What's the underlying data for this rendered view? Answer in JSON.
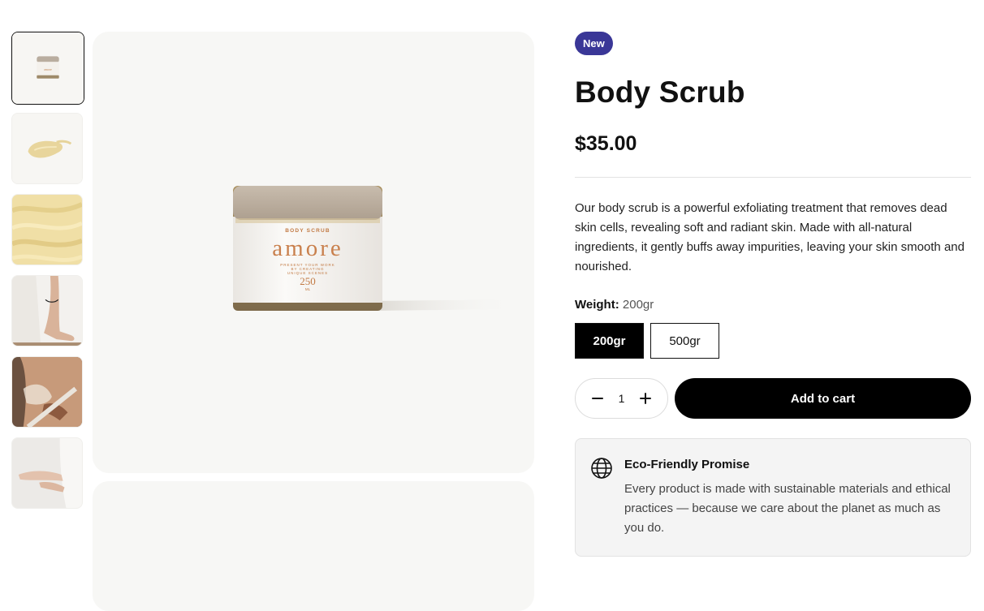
{
  "product": {
    "badge": "New",
    "title": "Body Scrub",
    "price": "$35.00",
    "description": "Our body scrub is a powerful exfoliating treatment that removes dead skin cells, revealing soft and radiant skin. Made with all-natural ingredients, it gently buffs away impurities, leaving your skin smooth and nourished.",
    "weight_label": "Weight:",
    "weight_value": "200gr",
    "options": [
      "200gr",
      "500gr"
    ],
    "quantity": "1",
    "add_to_cart": "Add to cart"
  },
  "jar": {
    "brand": "amore",
    "top_label": "BODY SCRUB",
    "tagline_1": "PRESENT YOUR WORK",
    "tagline_2": "BY CREATING",
    "tagline_3": "UNIQUE SCENES",
    "size": "250",
    "size_unit": "ML"
  },
  "eco": {
    "title": "Eco-Friendly Promise",
    "text": "Every product is made with sustainable materials and ethical practices — because we care about the planet as much as you do."
  },
  "icons": {
    "minus": "minus-icon",
    "plus": "plus-icon",
    "eco": "globe-icon"
  },
  "colors": {
    "badge": "#3a3797",
    "primary": "#000000",
    "panel": "#f4f4f4"
  }
}
